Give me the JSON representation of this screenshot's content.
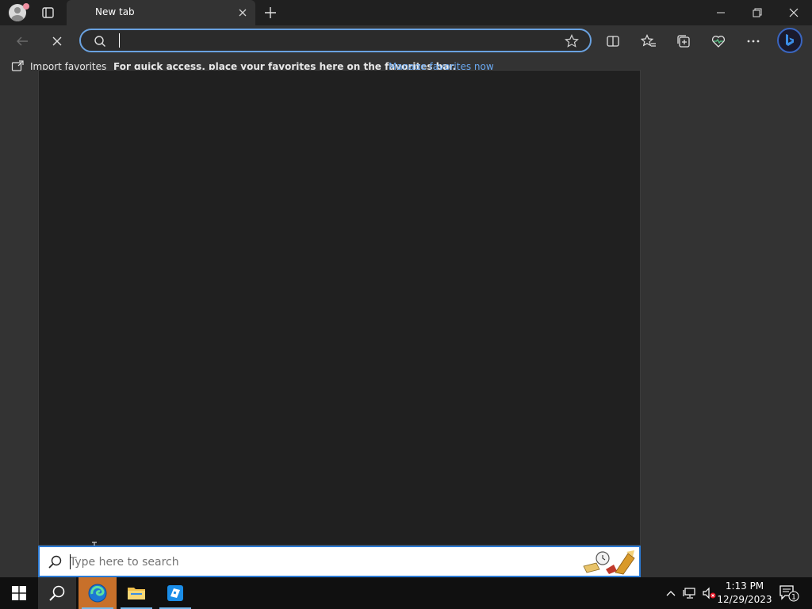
{
  "browser": {
    "tab": {
      "title": "New tab"
    },
    "address_bar": {
      "value": "",
      "placeholder": ""
    },
    "favorites_bar": {
      "import_label": "Import favorites",
      "message": "For quick access, place your favorites here on the favorites bar.",
      "manage_link": "Manage favorites now"
    }
  },
  "start_search": {
    "placeholder": "Type here to search",
    "value": ""
  },
  "taskbar": {
    "pinned": [
      "start-icon",
      "search-icon",
      "edge-icon",
      "file-explorer-icon",
      "roblox-studio-icon"
    ],
    "clock": {
      "time": "1:13 PM",
      "date": "12/29/2023"
    },
    "notification_count": "1"
  },
  "colors": {
    "accent": "#2b7bd6",
    "address_focus": "#6aa2e0",
    "link": "#6aa8f0",
    "taskbar": "#101010",
    "panel": "#202020"
  }
}
